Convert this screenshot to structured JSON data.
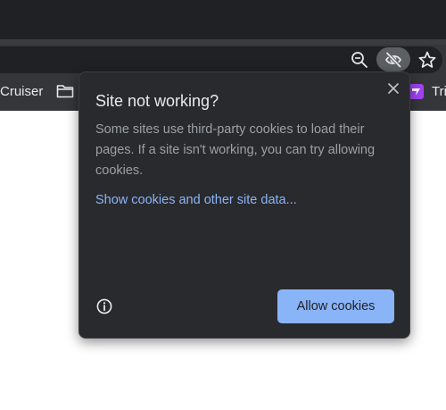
{
  "bookmarks_bar": {
    "items": [
      {
        "label": "Cruiser",
        "icon": "none"
      },
      {
        "label": "",
        "icon": "folder-icon"
      },
      {
        "label": "Tri",
        "icon": "purple-favicon"
      }
    ]
  },
  "toolbar": {
    "icons": [
      "zoom-out-icon",
      "eye-slash-icon",
      "star-icon"
    ]
  },
  "popup": {
    "title": "Site not working?",
    "description": "Some sites use third-party cookies to load their pages. If a site isn't working, you can try allowing cookies.",
    "link_label": "Show cookies and other site data...",
    "allow_button_label": "Allow cookies",
    "icons": [
      "close-icon",
      "info-icon"
    ]
  },
  "colors": {
    "chrome_dark": "#202124",
    "toolbar": "#35363a",
    "popup_bg": "#292a2d",
    "accent_blue": "#8ab4f8",
    "text_primary": "#e8eaed",
    "text_secondary": "#9aa0a6"
  }
}
